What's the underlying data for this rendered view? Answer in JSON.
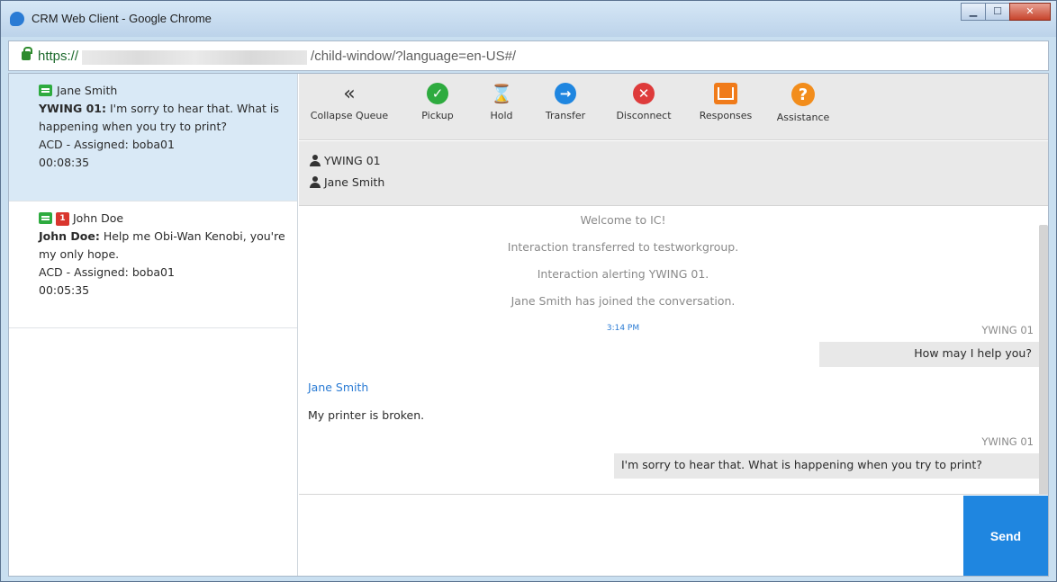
{
  "window": {
    "title": "CRM Web Client - Google Chrome"
  },
  "address": {
    "scheme": "https://",
    "path": "/child-window/?language=en-US#/"
  },
  "queue": {
    "items": [
      {
        "name": "Jane Smith",
        "sender": "YWING 01:",
        "message": "I'm sorry to hear that. What is happening when you try to print?",
        "status": "ACD - Assigned: boba01",
        "duration": "00:08:35",
        "badge": ""
      },
      {
        "name": "John Doe",
        "sender": "John Doe:",
        "message": "Help me Obi-Wan Kenobi, you're my only hope.",
        "status": "ACD - Assigned: boba01",
        "duration": "00:05:35",
        "badge": "1"
      }
    ]
  },
  "toolbar": {
    "collapse": "Collapse Queue",
    "pickup": "Pickup",
    "hold": "Hold",
    "transfer": "Transfer",
    "disconnect": "Disconnect",
    "responses": "Responses",
    "assistance": "Assistance"
  },
  "participants": [
    "YWING 01",
    "Jane Smith"
  ],
  "transcript": {
    "system": [
      "Welcome to IC!",
      "Interaction transferred to testworkgroup.",
      "Interaction alerting YWING 01.",
      "Jane Smith has joined the conversation."
    ],
    "time": "3:14 PM",
    "agent_name": "YWING 01",
    "agent_msg_1": "How may I help you?",
    "customer_name": "Jane Smith",
    "customer_msg": "My printer is broken.",
    "agent_msg_2": "I'm sorry to hear that.  What is happening when you try to print?"
  },
  "input": {
    "send_label": "Send"
  },
  "colors": {
    "accent": "#1f86e0",
    "pickup": "#2eab3f",
    "disconnect": "#de3b3b",
    "responses": "#f07b1a"
  }
}
